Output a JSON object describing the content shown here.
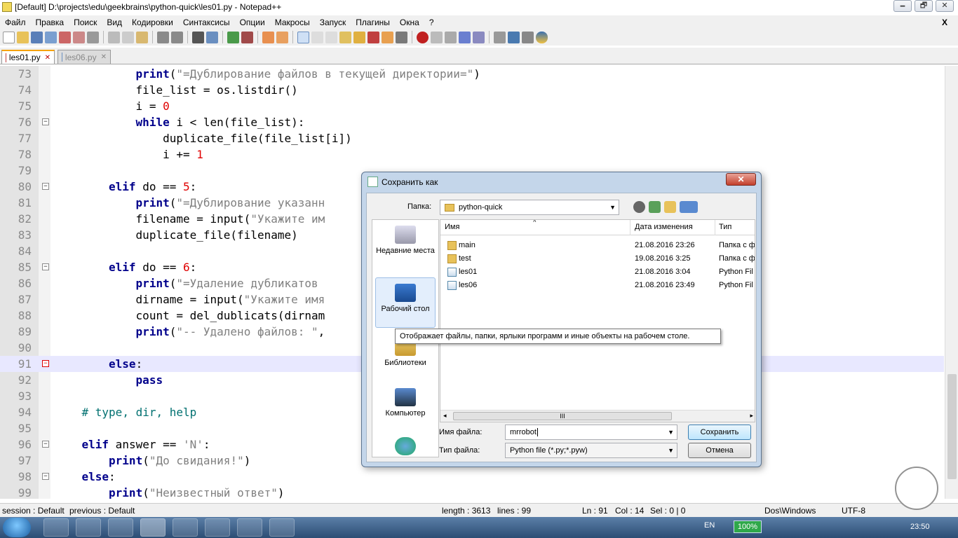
{
  "window": {
    "title": "[Default] D:\\projects\\edu\\geekbrains\\python-quick\\les01.py - Notepad++"
  },
  "window_buttons": [
    "🗕",
    "🗗",
    "✕"
  ],
  "menu": [
    "Файл",
    "Правка",
    "Поиск",
    "Вид",
    "Кодировки",
    "Синтаксисы",
    "Опции",
    "Макросы",
    "Запуск",
    "Плагины",
    "Окна",
    "?"
  ],
  "menu_close": "X",
  "tabs": [
    {
      "label": "les01.py",
      "active": true
    },
    {
      "label": "les06.py",
      "active": false
    }
  ],
  "code_lines": [
    {
      "n": "73",
      "indent": 12,
      "html": "<span class=\"k\">print</span>(<span class=\"s\">\"=Дублирование файлов в текущей директории=\"</span>)"
    },
    {
      "n": "74",
      "indent": 12,
      "html": "file_list = os.listdir()"
    },
    {
      "n": "75",
      "indent": 12,
      "html": "i = <span class=\"n\">0</span>"
    },
    {
      "n": "76",
      "indent": 12,
      "fold": "−",
      "html": "<span class=\"k\">while</span> i &lt; len(file_list):"
    },
    {
      "n": "77",
      "indent": 16,
      "html": "duplicate_file(file_list[i])"
    },
    {
      "n": "78",
      "indent": 16,
      "html": "i += <span class=\"n\">1</span>"
    },
    {
      "n": "79",
      "indent": 0,
      "html": ""
    },
    {
      "n": "80",
      "indent": 8,
      "fold": "−",
      "html": "<span class=\"k\">elif</span> do == <span class=\"n\">5</span>:"
    },
    {
      "n": "81",
      "indent": 12,
      "html": "<span class=\"k\">print</span>(<span class=\"s\">\"=Дублирование указанн</span>"
    },
    {
      "n": "82",
      "indent": 12,
      "html": "filename = input(<span class=\"s\">\"Укажите им</span>"
    },
    {
      "n": "83",
      "indent": 12,
      "html": "duplicate_file(filename)"
    },
    {
      "n": "84",
      "indent": 0,
      "html": ""
    },
    {
      "n": "85",
      "indent": 8,
      "fold": "−",
      "html": "<span class=\"k\">elif</span> do == <span class=\"n\">6</span>:"
    },
    {
      "n": "86",
      "indent": 12,
      "html": "<span class=\"k\">print</span>(<span class=\"s\">\"=Удаление дубликатов</span>"
    },
    {
      "n": "87",
      "indent": 12,
      "html": "dirname = input(<span class=\"s\">\"Укажите имя</span>"
    },
    {
      "n": "88",
      "indent": 12,
      "html": "count = del_dublicats(dirnam"
    },
    {
      "n": "89",
      "indent": 12,
      "html": "<span class=\"k\">print</span>(<span class=\"s\">\"-- Удалено файлов: \"</span>,"
    },
    {
      "n": "90",
      "indent": 0,
      "html": ""
    },
    {
      "n": "91",
      "indent": 8,
      "fold": "−",
      "foldred": true,
      "current": true,
      "html": "<span class=\"k\">else</span>:"
    },
    {
      "n": "92",
      "indent": 12,
      "html": "<span class=\"k\">pass</span>"
    },
    {
      "n": "93",
      "indent": 0,
      "html": ""
    },
    {
      "n": "94",
      "indent": 4,
      "html": "<span class=\"c\"># type, dir, help</span>"
    },
    {
      "n": "95",
      "indent": 0,
      "html": ""
    },
    {
      "n": "96",
      "indent": 4,
      "fold": "−",
      "html": "<span class=\"k\">elif</span> answer == <span class=\"s\">'N'</span>:"
    },
    {
      "n": "97",
      "indent": 8,
      "html": "<span class=\"k\">print</span>(<span class=\"s\">\"До свидания!\"</span>)"
    },
    {
      "n": "98",
      "indent": 4,
      "fold": "−",
      "html": "<span class=\"k\">else</span>:"
    },
    {
      "n": "99",
      "indent": 8,
      "html": "<span class=\"k\">print</span>(<span class=\"s\">\"Неизвестный ответ\"</span>)"
    }
  ],
  "dialog": {
    "title": "Сохранить как",
    "close": "✕",
    "folder_label": "Папка:",
    "folder_value": "python-quick",
    "places": [
      "Недавние места",
      "Рабочий стол",
      "Библиотеки",
      "Компьютер",
      ""
    ],
    "columns": [
      "Имя",
      "Дата изменения",
      "Тип"
    ],
    "files": [
      {
        "name": "main",
        "date": "21.08.2016 23:26",
        "type": "Папка с ф",
        "kind": "folder"
      },
      {
        "name": "test",
        "date": "19.08.2016 3:25",
        "type": "Папка с ф",
        "kind": "folder"
      },
      {
        "name": "les01",
        "date": "21.08.2016 3:04",
        "type": "Python Fil",
        "kind": "py"
      },
      {
        "name": "les06",
        "date": "21.08.2016 23:49",
        "type": "Python Fil",
        "kind": "py"
      }
    ],
    "filename_label": "Имя файла:",
    "filename_value": "mrrobot",
    "filetype_label": "Тип файла:",
    "filetype_value": "Python file (*.py;*.pyw)",
    "save_button": "Сохранить",
    "cancel_button": "Отмена",
    "scroll_grip": "III",
    "scroll_left": "◂",
    "scroll_right": "▸"
  },
  "tooltip": "Отображает файлы, папки, ярлыки программ и иные объекты на рабочем столе.",
  "status": {
    "session": "session : Default",
    "previous": "previous : Default",
    "length": "length : 3613",
    "lines": "lines : 99",
    "ln": "Ln : 91",
    "col": "Col : 14",
    "sel": "Sel : 0 | 0",
    "eol": "Dos\\Windows",
    "encoding": "UTF-8"
  },
  "taskbar": {
    "lang": "EN",
    "battery": "100%",
    "clock": "23:50"
  },
  "colors": {
    "keyword": "#00008b",
    "string": "#808080",
    "number": "#e00000",
    "comment": "#007070",
    "current_line": "#e8e8ff"
  }
}
